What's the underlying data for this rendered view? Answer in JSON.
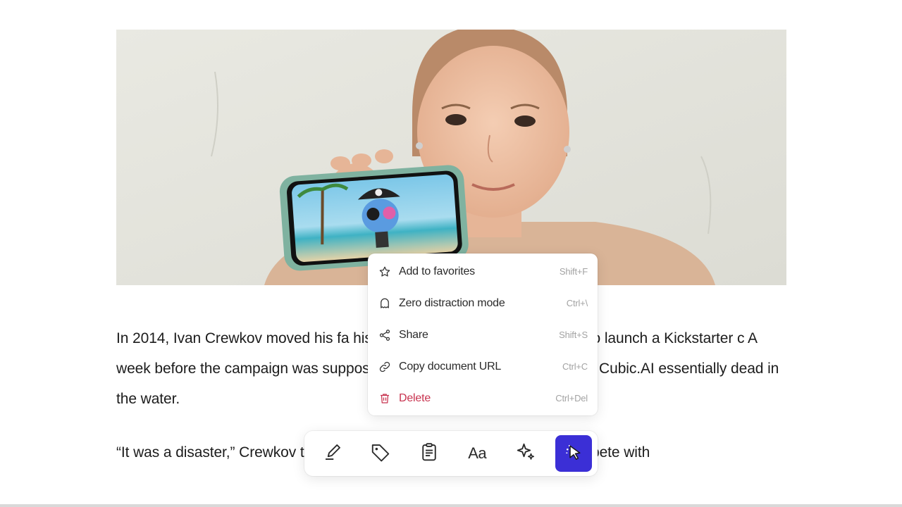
{
  "article": {
    "paragraphs": [
      "In 2014, Ivan Crewkov moved his fa                                        his startup, Cubic.AI, was preparing to launch a Kickstarter c                                        A week before the campaign was supposed to go live                                        art speaker, rendering Cubic.AI essentially dead in the water.",
      "“It was a disaster,” Crewkov told TechCrunch. “It made zero sense to compete with"
    ]
  },
  "context_menu": {
    "items": [
      {
        "label": "Add to favorites",
        "shortcut": "Shift+F",
        "icon": "star-icon"
      },
      {
        "label": "Zero distraction mode",
        "shortcut": "Ctrl+\\",
        "icon": "ghost-icon"
      },
      {
        "label": "Share",
        "shortcut": "Shift+S",
        "icon": "share-icon"
      },
      {
        "label": "Copy document URL",
        "shortcut": "Ctrl+C",
        "icon": "link-icon"
      },
      {
        "label": "Delete",
        "shortcut": "Ctrl+Del",
        "icon": "trash-icon"
      }
    ]
  },
  "toolbar": {
    "buttons": [
      {
        "icon": "highlighter-icon"
      },
      {
        "icon": "tag-icon"
      },
      {
        "icon": "clipboard-icon"
      },
      {
        "icon": "text-style-icon",
        "label": "Aa"
      },
      {
        "icon": "sparkle-icon"
      },
      {
        "icon": "pointer-icon",
        "active": true
      }
    ]
  },
  "colors": {
    "accent": "#3b2fd6",
    "danger": "#c8334f",
    "shortcut_text": "#a3a3a3"
  }
}
